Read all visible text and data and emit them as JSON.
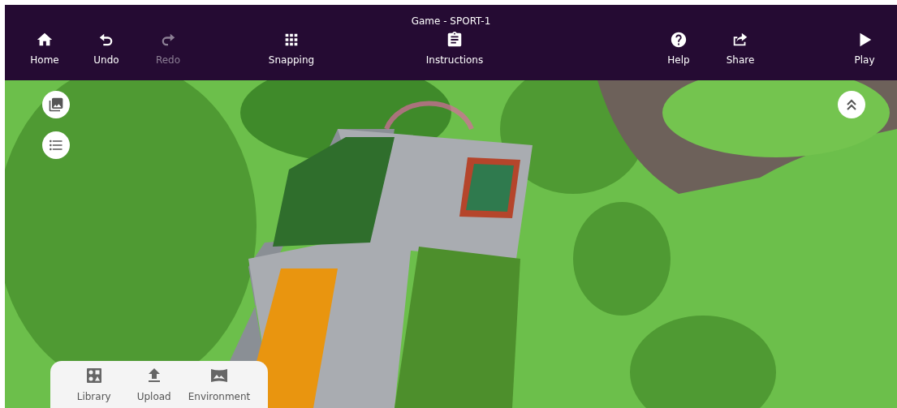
{
  "window": {
    "title": "Game - SPORT-1"
  },
  "toolbar": [
    {
      "label": "Home",
      "kind": "home",
      "disabled": false
    },
    {
      "label": "Undo",
      "kind": "undo",
      "disabled": false
    },
    {
      "label": "Redo",
      "kind": "redo",
      "disabled": true
    },
    {
      "label": "Snapping",
      "kind": "grid",
      "disabled": false
    },
    {
      "label": "Instructions",
      "kind": "clipboard",
      "disabled": false
    },
    {
      "label": "Help",
      "kind": "help",
      "disabled": false
    },
    {
      "label": "Share",
      "kind": "share",
      "disabled": false
    },
    {
      "label": "Play",
      "kind": "play",
      "disabled": false
    }
  ],
  "bottom_panel": [
    {
      "label": "Library",
      "kind": "library"
    },
    {
      "label": "Upload",
      "kind": "upload"
    },
    {
      "label": "Environment",
      "kind": "environment"
    }
  ]
}
